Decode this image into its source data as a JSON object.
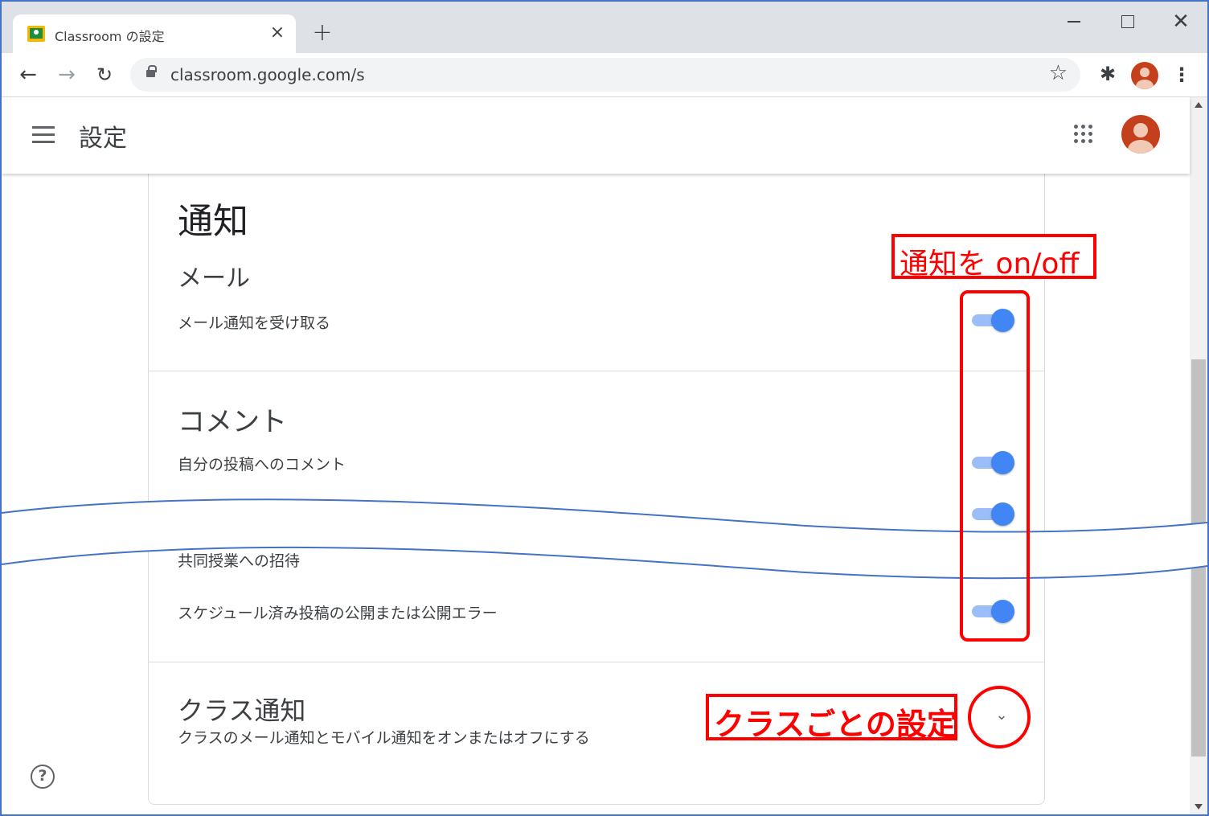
{
  "browser": {
    "tab_title": "Classroom の設定",
    "tab_close": "×",
    "new_tab": "+",
    "url": "classroom.google.com/s",
    "back": "←",
    "forward": "→",
    "reload": "↻",
    "star": "☆",
    "extensions": "✱",
    "menu": "⋮",
    "win_close": "✕"
  },
  "header": {
    "title": "設定"
  },
  "notifications": {
    "heading": "通知",
    "email": {
      "heading": "メール",
      "rows": [
        {
          "label": "メール通知を受け取る",
          "enabled": true
        }
      ]
    },
    "comments": {
      "heading": "コメント",
      "rows": [
        {
          "label": "自分の投稿へのコメント",
          "enabled": true
        },
        {
          "label": "",
          "enabled": true
        }
      ]
    },
    "other_rows": [
      {
        "label": "共同授業への招待"
      },
      {
        "label": "スケジュール済み投稿の公開または公開エラー",
        "enabled": true
      }
    ],
    "class_notifications": {
      "heading": "クラス通知",
      "description": "クラスのメール通知とモバイル通知をオンまたはオフにする",
      "chevron": "⌄"
    }
  },
  "help": {
    "icon_text": "?"
  },
  "annotations": {
    "toggle_label": "通知を on/off",
    "class_label": "クラスごとの設定",
    "color": "#ff0000"
  },
  "colors": {
    "toggle_on": "#4285f4",
    "toggle_track": "#9bbdf8",
    "frame_border": "#4472c4",
    "avatar": "#c4401d"
  }
}
